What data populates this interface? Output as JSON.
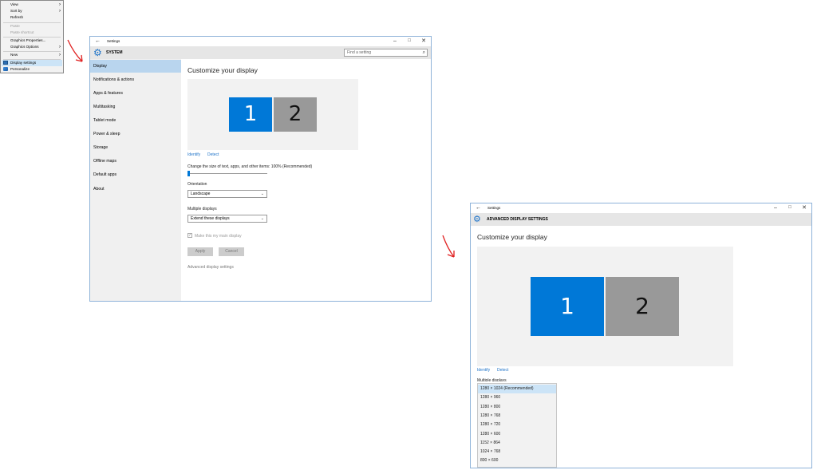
{
  "context_menu": {
    "items": [
      {
        "label": "View",
        "has_submenu": true
      },
      {
        "label": "Sort by",
        "has_submenu": true
      },
      {
        "label": "Refresh"
      },
      {
        "label": "Paste",
        "disabled": true
      },
      {
        "label": "Paste shortcut",
        "disabled": true
      },
      {
        "label": "Graphics Properties..."
      },
      {
        "label": "Graphics Options",
        "has_submenu": true
      },
      {
        "label": "New",
        "has_submenu": true
      },
      {
        "label": "Display settings",
        "icon": "display-icon",
        "highlighted": true
      },
      {
        "label": "Personalize",
        "icon": "personalize-icon"
      }
    ]
  },
  "settings_window": {
    "title": "Settings",
    "section": "SYSTEM",
    "search_placeholder": "Find a setting",
    "nav": [
      "Display",
      "Notifications & actions",
      "Apps & features",
      "Multitasking",
      "Tablet mode",
      "Power & sleep",
      "Storage",
      "Offline maps",
      "Default apps",
      "About"
    ],
    "selected_nav": "Display",
    "heading": "Customize your display",
    "monitors": [
      "1",
      "2"
    ],
    "identify": "Identify",
    "detect": "Detect",
    "scale_label": "Change the size of text, apps, and other items: 100% (Recommended)",
    "scale_value": 0,
    "orientation_label": "Orientation",
    "orientation_value": "Landscape",
    "multiple_label": "Multiple displays",
    "multiple_value": "Extend these displays",
    "main_display_label": "Make this my main display",
    "apply": "Apply",
    "cancel": "Cancel",
    "advanced_link": "Advanced display settings"
  },
  "advanced_window": {
    "title": "Settings",
    "section": "ADVANCED DISPLAY SETTINGS",
    "heading": "Customize your display",
    "monitors": [
      "1",
      "2"
    ],
    "identify": "Identify",
    "detect": "Detect",
    "partial_label": "Multiple displays",
    "resolutions": [
      "1280 × 1024 (Recommended)",
      "1280 × 960",
      "1280 × 800",
      "1280 × 768",
      "1280 × 720",
      "1280 × 600",
      "1152 × 864",
      "1024 × 768",
      "800 × 600"
    ],
    "selected_resolution": "1280 × 1024 (Recommended)"
  },
  "colors": {
    "accent": "#0078d7",
    "selection": "#b9d5ee",
    "arrow": "#e02020"
  }
}
